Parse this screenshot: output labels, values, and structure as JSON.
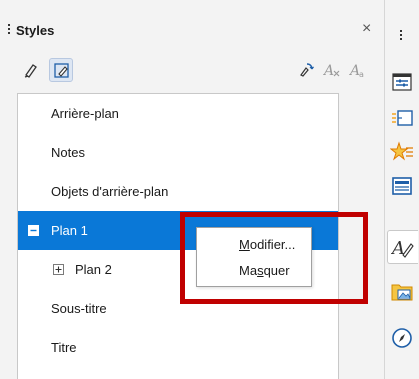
{
  "panel": {
    "title": "Styles",
    "close_glyph": "×"
  },
  "toolbar": {
    "icons": [
      "fill-format-mode-icon",
      "new-style-from-selection-icon",
      "update-style-icon",
      "new-style-icon",
      "style-actions-icon"
    ]
  },
  "styles_list": {
    "items": [
      {
        "label": "Arrière-plan",
        "selected": false
      },
      {
        "label": "Notes",
        "selected": false
      },
      {
        "label": "Objets d'arrière-plan",
        "selected": false
      },
      {
        "label": "Plan 1",
        "selected": true,
        "expander": "collapse"
      },
      {
        "label": "Plan 2",
        "selected": false,
        "expander": "expand"
      },
      {
        "label": "Sous-titre",
        "selected": false
      },
      {
        "label": "Titre",
        "selected": false
      }
    ]
  },
  "context_menu": {
    "modify": {
      "accel": "M",
      "rest": "odifier..."
    },
    "hide": {
      "pre": "Ma",
      "accel": "s",
      "rest": "quer"
    }
  },
  "sidebar": {
    "icons": [
      "properties-icon",
      "slide-transition-icon",
      "animation-icon",
      "master-slides-icon",
      "styles-icon",
      "gallery-icon",
      "navigator-icon"
    ],
    "active": "styles-icon"
  },
  "annotation": {
    "color": "#c00000"
  },
  "colors": {
    "selection": "#0a78d7",
    "accent_orange": "#f5a623",
    "icon_blue": "#1f5fa8"
  }
}
